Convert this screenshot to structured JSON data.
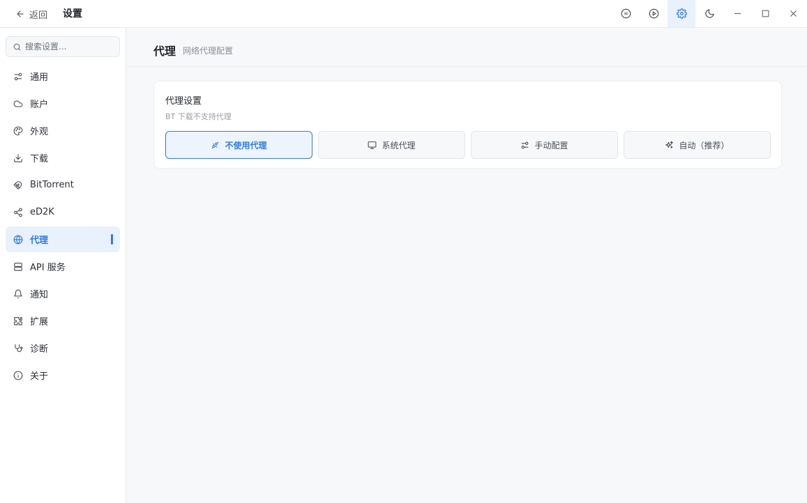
{
  "titlebar": {
    "back_label": "返回",
    "title": "设置",
    "icons": [
      "pause-circle-icon",
      "play-circle-icon",
      "gear-icon",
      "moon-icon",
      "minimize-icon",
      "maximize-icon",
      "close-icon"
    ]
  },
  "sidebar": {
    "search_placeholder": "搜索设置...",
    "items": [
      {
        "label": "通用",
        "icon": "sliders-icon"
      },
      {
        "label": "账户",
        "icon": "cloud-icon"
      },
      {
        "label": "外观",
        "icon": "palette-icon"
      },
      {
        "label": "下载",
        "icon": "download-icon"
      },
      {
        "label": "BitTorrent",
        "icon": "magnet-icon"
      },
      {
        "label": "eD2K",
        "icon": "share-icon"
      },
      {
        "label": "代理",
        "icon": "globe-icon",
        "active": true
      },
      {
        "label": "API 服务",
        "icon": "server-icon"
      },
      {
        "label": "通知",
        "icon": "bell-icon"
      },
      {
        "label": "扩展",
        "icon": "puzzle-icon"
      },
      {
        "label": "诊断",
        "icon": "stethoscope-icon"
      },
      {
        "label": "关于",
        "icon": "info-icon"
      }
    ]
  },
  "main": {
    "title": "代理",
    "subtitle": "网络代理配置",
    "card": {
      "title": "代理设置",
      "description": "BT 下载不支持代理",
      "options": [
        {
          "label": "不使用代理",
          "icon": "plug-off-icon",
          "selected": true
        },
        {
          "label": "系统代理",
          "icon": "monitor-icon"
        },
        {
          "label": "手动配置",
          "icon": "sliders-icon"
        },
        {
          "label": "自动（推荐）",
          "icon": "sparkles-icon"
        }
      ]
    }
  },
  "colors": {
    "accent": "#2f7ae5",
    "accent_bg": "#e9f1fd",
    "main_bg": "#f7f8fa"
  }
}
